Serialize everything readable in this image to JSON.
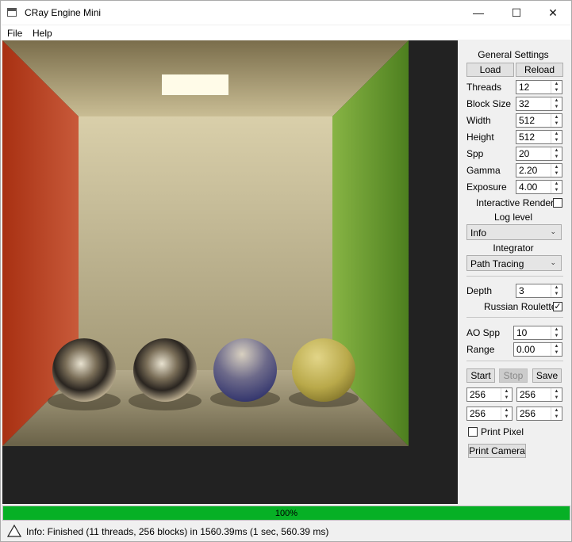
{
  "window": {
    "title": "CRay Engine Mini"
  },
  "menu": [
    "File",
    "Help"
  ],
  "panel": {
    "general_title": "General Settings",
    "load": "Load",
    "reload": "Reload",
    "fields": [
      {
        "label": "Threads",
        "value": "12"
      },
      {
        "label": "Block Size",
        "value": "32"
      },
      {
        "label": "Width",
        "value": "512"
      },
      {
        "label": "Height",
        "value": "512"
      },
      {
        "label": "Spp",
        "value": "20"
      },
      {
        "label": "Gamma",
        "value": "2.20"
      },
      {
        "label": "Exposure",
        "value": "4.00"
      }
    ],
    "interactive_render": "Interactive Render",
    "interactive_checked": false,
    "log_level_label": "Log level",
    "log_level_value": "Info",
    "integrator_label": "Integrator",
    "integrator_value": "Path Tracing",
    "depth_label": "Depth",
    "depth_value": "3",
    "russian_roulette": "Russian Roulette",
    "russian_roulette_checked": true,
    "ao_spp_label": "AO Spp",
    "ao_spp_value": "10",
    "range_label": "Range",
    "range_value": "0.00",
    "start": "Start",
    "stop": "Stop",
    "save": "Save",
    "region": [
      "256",
      "256",
      "256",
      "256"
    ],
    "print_pixel": "Print Pixel",
    "print_camera": "Print Camera"
  },
  "progress": {
    "value": 1.0,
    "label": "100%"
  },
  "status": {
    "text": "Info: Finished (11 threads, 256 blocks) in 1560.39ms (1 sec, 560.39 ms)"
  },
  "colors": {
    "progress": "#06b025",
    "left_wall": "#b83a20",
    "right_wall": "#5e9a2a",
    "viewport_bg": "#222222"
  }
}
